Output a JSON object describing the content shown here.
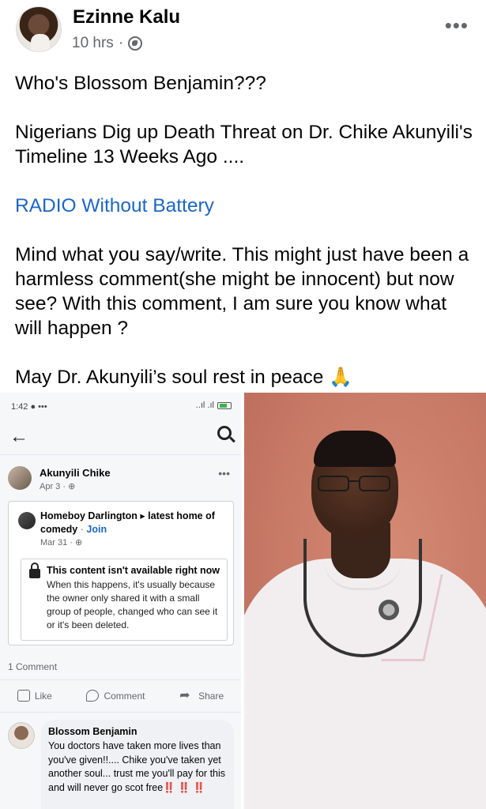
{
  "post": {
    "author": "Ezinne Kalu",
    "time": "10 hrs",
    "separator": "·",
    "paragraphs": [
      "Who's Blossom Benjamin???",
      "Nigerians Dig up Death Threat on Dr. Chike Akunyili's Timeline 13 Weeks Ago ....",
      "RADIO Without Battery",
      "Mind what you say/write. This might just have been a harmless comment(she might be innocent) but now see? With this comment, I am sure you know what will happen ?",
      "May Dr. Akunyili’s soul rest in peace"
    ],
    "emoji": "🙏",
    "link_color": "#1b67c7"
  },
  "screenshot": {
    "status_time": "1:42",
    "status_signal": "..ıl .ıl",
    "poster_name": "Akunyili Chike",
    "poster_date": "Apr 3 ·",
    "shared_from": "Homeboy Darlington",
    "arrow": "▸",
    "group": "latest home of comedy",
    "dot": "·",
    "join": "Join",
    "shared_date": "Mar 31 ·",
    "notice_title": "This content isn't available right now",
    "notice_body": "When this happens, it's usually because the owner only shared it with a small group of people, changed who can see it or it's been deleted.",
    "comment_count": "1 Comment",
    "actions": {
      "like": "Like",
      "comment": "Comment",
      "share": "Share"
    },
    "commenter": "Blossom Benjamin",
    "comment_text": "You doctors have taken more lives than you've given!!.... Chike you've taken yet another soul... trust me you'll pay for this and will never go scot free",
    "comment_bangs": "‼️ ‼️ ‼️"
  }
}
